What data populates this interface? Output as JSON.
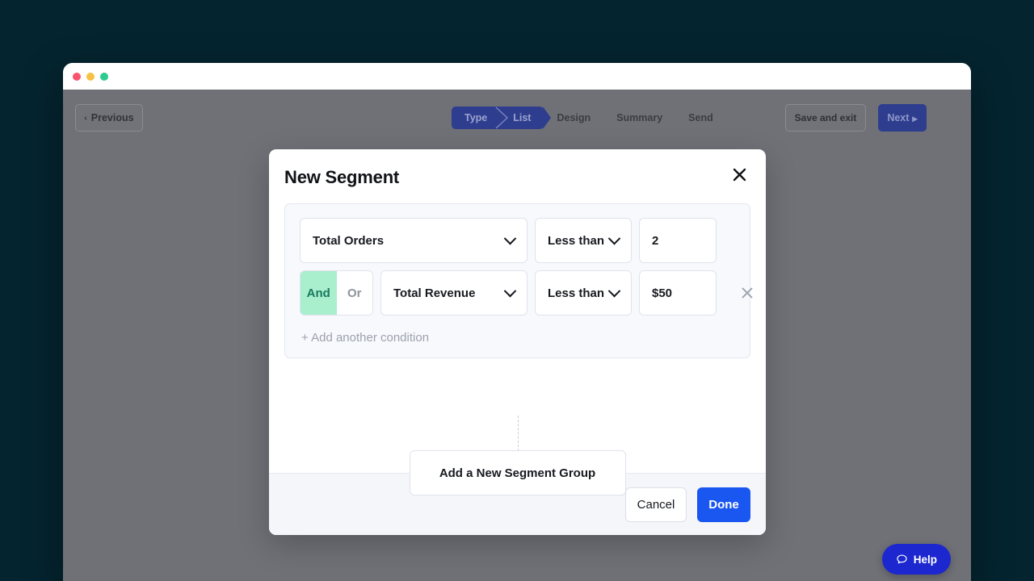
{
  "window": {
    "traffic_lights": [
      "close",
      "minimize",
      "maximize"
    ]
  },
  "topbar": {
    "previous_label": "Previous",
    "previous_chevron": "‹",
    "save_and_exit_label": "Save and exit",
    "next_label": "Next",
    "next_chevron": "▸",
    "steps": [
      {
        "label": "Type",
        "active": true
      },
      {
        "label": "List",
        "active": true
      },
      {
        "label": "Design",
        "active": false
      },
      {
        "label": "Summary",
        "active": false
      },
      {
        "label": "Send",
        "active": false
      }
    ]
  },
  "modal": {
    "title": "New Segment",
    "close_icon": "×",
    "conditions": [
      {
        "attribute": "Total Orders",
        "operator": "Less than",
        "value": "2",
        "has_logic_toggle": false,
        "has_remove": false
      },
      {
        "logic": {
          "and_label": "And",
          "or_label": "Or",
          "selected": "And"
        },
        "attribute": "Total Revenue",
        "operator": "Less than",
        "value": "$50",
        "has_logic_toggle": true,
        "has_remove": true,
        "remove_icon": "×"
      }
    ],
    "add_condition_label": "+ Add another condition",
    "add_segment_group_label": "Add a New Segment Group",
    "footer": {
      "cancel_label": "Cancel",
      "done_label": "Done"
    }
  },
  "help": {
    "label": "Help",
    "icon": "speech-bubble-icon"
  },
  "colors": {
    "page_background": "#04242f",
    "overlay": "#6f7177",
    "accent_blue": "#1a56f0",
    "step_blue": "#2f3d8e",
    "toggle_green_bg": "#a9eecd",
    "toggle_green_text": "#1a7a5e",
    "help_blue": "#1c27cf"
  }
}
